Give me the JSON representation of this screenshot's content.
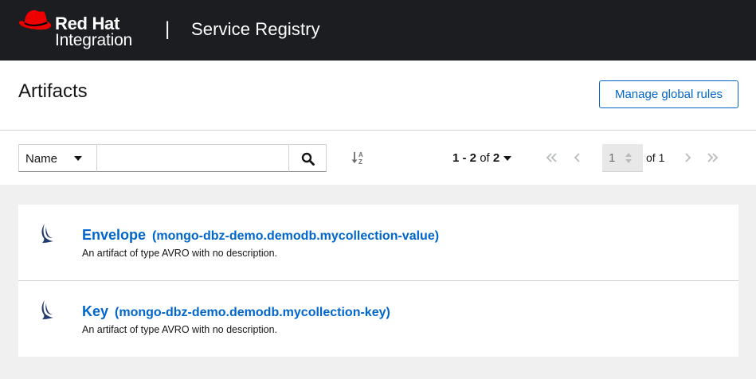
{
  "header": {
    "brand_line1": "Red Hat",
    "brand_line2": "Integration",
    "divider": "|",
    "app_title": "Service Registry"
  },
  "page": {
    "title": "Artifacts",
    "manage_rules_label": "Manage global rules"
  },
  "toolbar": {
    "filter_by": "Name",
    "search_value": "",
    "search_placeholder": "",
    "pagination": {
      "range": "1 - 2",
      "of_word": "of",
      "total": "2",
      "current_page": "1",
      "of_pages": "of 1"
    }
  },
  "artifacts": [
    {
      "name": "Envelope",
      "id": "(mongo-dbz-demo.demodb.mycollection-value)",
      "description": "An artifact of type AVRO with no description.",
      "icon": "avro-icon"
    },
    {
      "name": "Key",
      "id": "(mongo-dbz-demo.demodb.mycollection-key)",
      "description": "An artifact of type AVRO with no description.",
      "icon": "avro-icon"
    }
  ],
  "colors": {
    "masthead": "#1b1d21",
    "brand_red": "#ee0000",
    "link_blue": "#0066cc",
    "avro_navy": "#1e3a6e",
    "page_bg": "#f0f0f0"
  }
}
